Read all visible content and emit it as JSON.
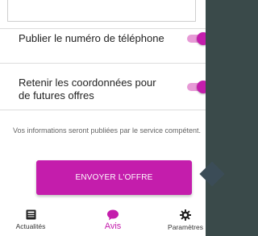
{
  "settings": {
    "publish_phone_label": "Publier le numéro de téléphone",
    "publish_phone_enabled": true,
    "retain_contact_label": "Retenir les coordonnées pour de futures offres",
    "retain_contact_enabled": true
  },
  "info_note": "Vos informations seront publiées par le service compétent.",
  "send_button_label": "ENVOYER L'OFFRE",
  "bottom_nav": {
    "items": [
      {
        "label": "Actualités",
        "icon": "news-icon",
        "active": false
      },
      {
        "label": "Avis",
        "icon": "chat-bubble-icon",
        "active": true
      },
      {
        "label": "Paramètres",
        "icon": "gear-icon",
        "active": false
      }
    ]
  },
  "colors": {
    "accent": "#c41dac",
    "switch_track": "#e79ad6",
    "background_edge": "#3a4a4a"
  }
}
